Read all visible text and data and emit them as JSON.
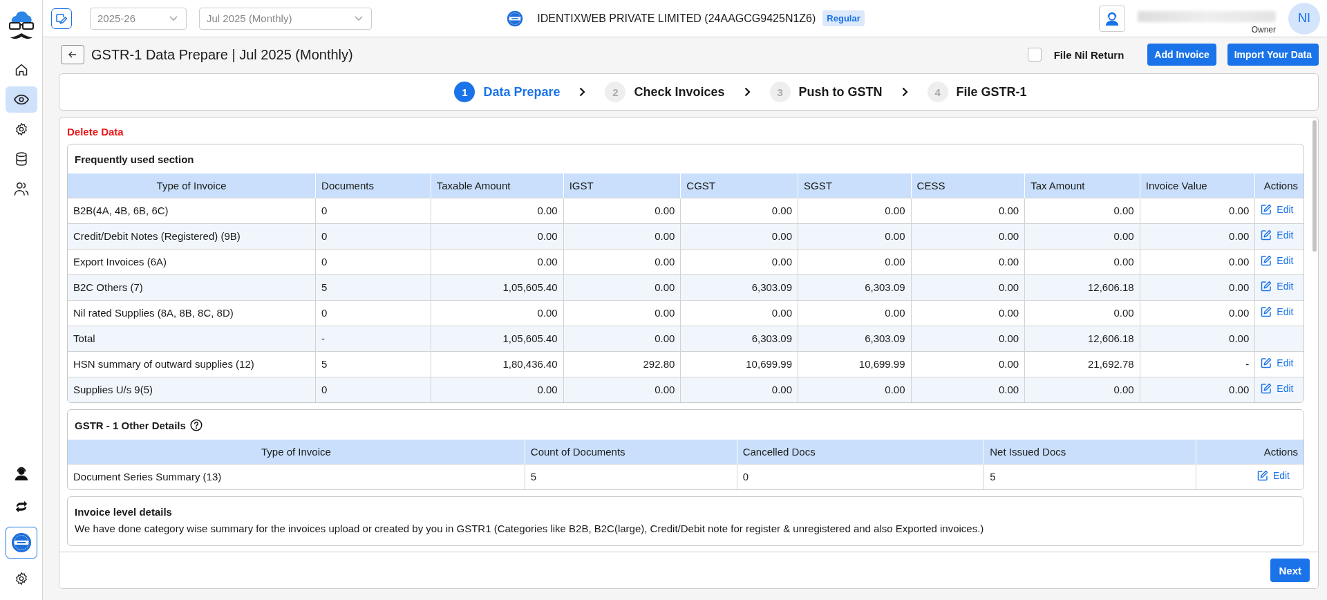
{
  "sidebar": {
    "top_items": [
      {
        "selected": false
      },
      {
        "selected": true
      },
      {
        "selected": false
      },
      {
        "selected": false
      },
      {
        "selected": false
      }
    ],
    "bottom_items": [
      {
        "selected": false
      },
      {
        "selected": false
      },
      {
        "selected": true
      },
      {
        "selected": false
      }
    ]
  },
  "topbar": {
    "financial_year": "2025-26",
    "period": "Jul 2025 (Monthly)",
    "company": "IDENTIXWEB PRIVATE LIMITED (24AAGCG9425N1Z6)",
    "badge": "Regular",
    "avatar": "NI",
    "role": "Owner"
  },
  "page": {
    "title": "GSTR-1 Data Prepare | Jul 2025 (Monthly)",
    "nil_return": {
      "label": "File Nil Return",
      "checked": false
    },
    "buttons": [
      "Add Invoice",
      "Import Your Data"
    ]
  },
  "steps": [
    {
      "number": "1",
      "label": "Data Prepare",
      "selected": true
    },
    {
      "number": "2",
      "label": "Check Invoices",
      "selected": false
    },
    {
      "number": "3",
      "label": "Push to GSTN",
      "selected": false
    },
    {
      "number": "4",
      "label": "File GSTR-1",
      "selected": false
    }
  ],
  "delete_link": "Delete Data",
  "frequent_section": {
    "title": "Frequently used section",
    "columns": [
      "Type of Invoice",
      "Documents",
      "Taxable Amount",
      "IGST",
      "CGST",
      "SGST",
      "CESS",
      "Tax Amount",
      "Invoice Value",
      "Actions"
    ],
    "rows": [
      {
        "cells": [
          "B2B(4A, 4B, 6B, 6C)",
          "0",
          "0.00",
          "0.00",
          "0.00",
          "0.00",
          "0.00",
          "0.00",
          "0.00"
        ],
        "action": "Edit"
      },
      {
        "cells": [
          "Credit/Debit Notes (Registered) (9B)",
          "0",
          "0.00",
          "0.00",
          "0.00",
          "0.00",
          "0.00",
          "0.00",
          "0.00"
        ],
        "action": "Edit"
      },
      {
        "cells": [
          "Export Invoices (6A)",
          "0",
          "0.00",
          "0.00",
          "0.00",
          "0.00",
          "0.00",
          "0.00",
          "0.00"
        ],
        "action": "Edit"
      },
      {
        "cells": [
          "B2C Others (7)",
          "5",
          "1,05,605.40",
          "0.00",
          "6,303.09",
          "6,303.09",
          "0.00",
          "12,606.18",
          "0.00"
        ],
        "action": "Edit"
      },
      {
        "cells": [
          "Nil rated Supplies (8A, 8B, 8C, 8D)",
          "0",
          "0.00",
          "0.00",
          "0.00",
          "0.00",
          "0.00",
          "0.00",
          "0.00"
        ],
        "action": "Edit"
      },
      {
        "cells": [
          "Total",
          "-",
          "1,05,605.40",
          "0.00",
          "6,303.09",
          "6,303.09",
          "0.00",
          "12,606.18",
          "0.00"
        ]
      },
      {
        "cells": [
          "HSN summary of outward supplies (12)",
          "5",
          "1,80,436.40",
          "292.80",
          "10,699.99",
          "10,699.99",
          "0.00",
          "21,692.78",
          "-"
        ],
        "action": "Edit"
      },
      {
        "cells": [
          "Supplies U/s 9(5)",
          "0",
          "0.00",
          "0.00",
          "0.00",
          "0.00",
          "0.00",
          "0.00",
          "0.00"
        ],
        "action": "Edit"
      }
    ]
  },
  "other_section": {
    "title": "GSTR - 1 Other Details",
    "columns": [
      "Type of Invoice",
      "Count of Documents",
      "Cancelled Docs",
      "Net Issued Docs",
      "Actions"
    ],
    "rows": [
      {
        "cells": [
          "Document Series Summary (13)",
          "5",
          "0",
          "5"
        ],
        "action": "Edit"
      }
    ]
  },
  "invoice_section": {
    "title": "Invoice level details",
    "text": "We have done category wise summary for the invoices upload or created by you in GSTR1 (Categories like B2B, B2C(large), Credit/Debit note for register & unregistered and also Exported invoices.)"
  },
  "next_button": "Next"
}
